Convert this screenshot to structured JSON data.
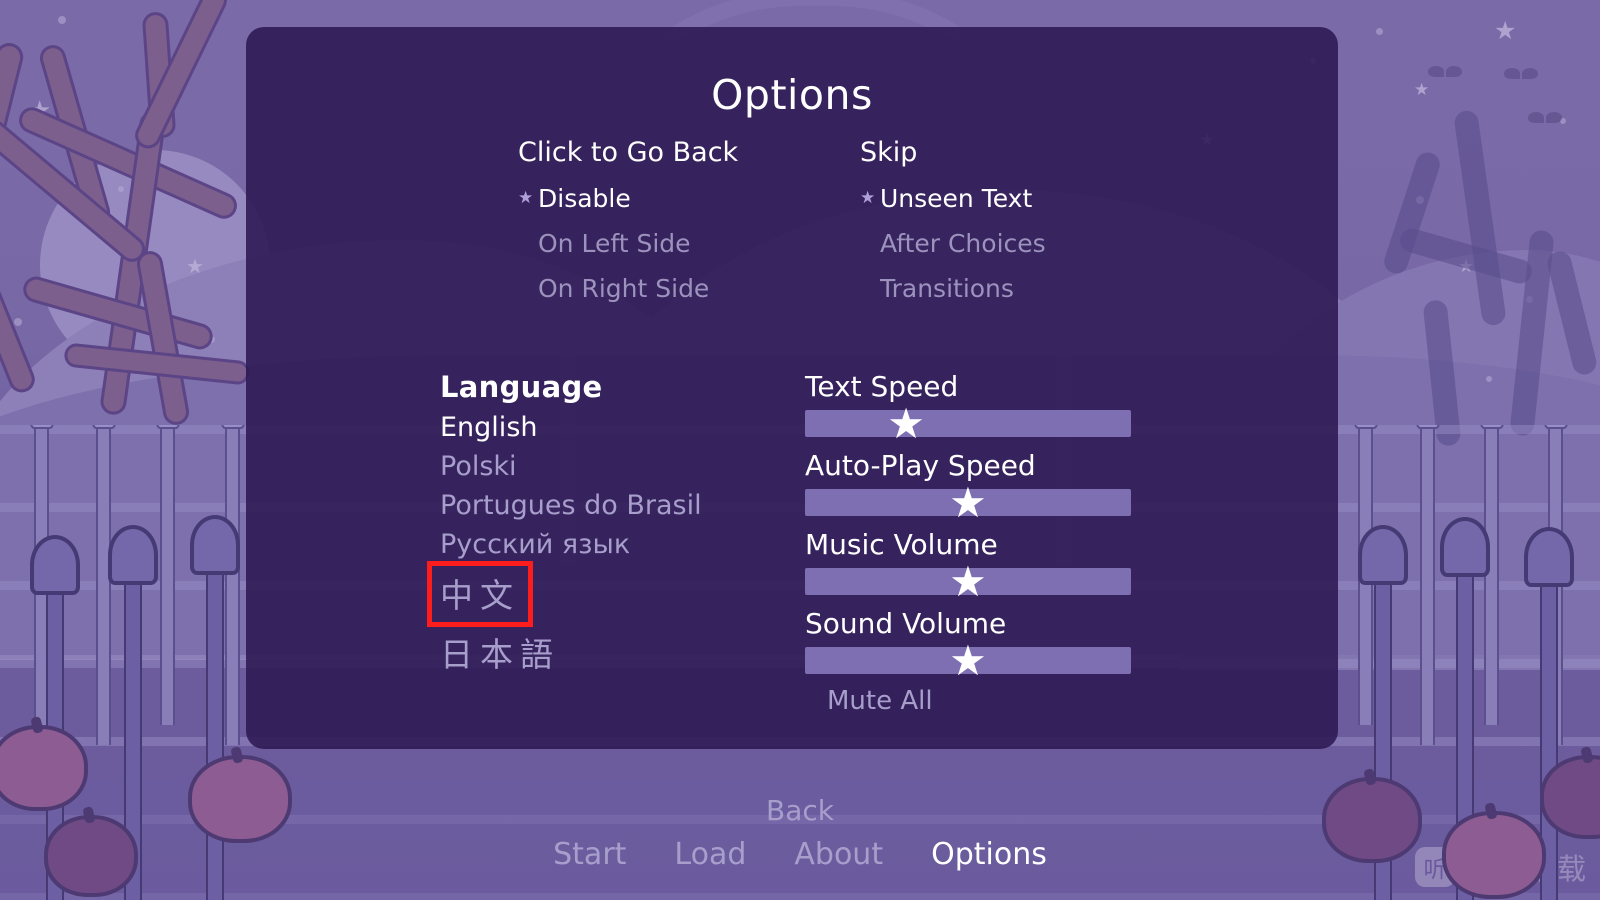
{
  "panel": {
    "title": "Options"
  },
  "prefs": [
    {
      "name": "click-to-go-back",
      "heading": "Click to Go Back",
      "options": [
        {
          "label": "Disable",
          "selected": true
        },
        {
          "label": "On Left Side",
          "selected": false
        },
        {
          "label": "On Right Side",
          "selected": false
        }
      ]
    },
    {
      "name": "skip",
      "heading": "Skip",
      "options": [
        {
          "label": "Unseen Text",
          "selected": true
        },
        {
          "label": "After Choices",
          "selected": false
        },
        {
          "label": "Transitions",
          "selected": false
        }
      ]
    }
  ],
  "language": {
    "title": "Language",
    "items": [
      {
        "label": "English",
        "current": true,
        "boxed": false,
        "cjk": false
      },
      {
        "label": "Polski",
        "current": false,
        "boxed": false,
        "cjk": false
      },
      {
        "label": "Portugues do Brasil",
        "current": false,
        "boxed": false,
        "cjk": false
      },
      {
        "label": "Русский язык",
        "current": false,
        "boxed": false,
        "cjk": false
      },
      {
        "label": "中文",
        "current": false,
        "boxed": true,
        "cjk": true
      },
      {
        "label": "日本語",
        "current": false,
        "boxed": false,
        "cjk": true
      }
    ]
  },
  "sliders": [
    {
      "name": "text-speed",
      "label": "Text Speed",
      "value": 31
    },
    {
      "name": "auto-play-speed",
      "label": "Auto-Play Speed",
      "value": 50
    },
    {
      "name": "music-volume",
      "label": "Music Volume",
      "value": 50
    },
    {
      "name": "sound-volume",
      "label": "Sound Volume",
      "value": 50
    }
  ],
  "mute_all": "Mute All",
  "nav": {
    "back": "Back",
    "items": [
      {
        "label": "Start",
        "active": false
      },
      {
        "label": "Load",
        "active": false
      },
      {
        "label": "About",
        "active": false
      },
      {
        "label": "Options",
        "active": true
      }
    ]
  },
  "watermark": {
    "icon_glyph": "听",
    "text": "一听下载"
  },
  "icons": {
    "selected_bullet": "star-bullet-icon",
    "slider_knob": "star-knob-icon"
  },
  "colors": {
    "panel_bg": "#2c1852",
    "accent_white": "#ffffff",
    "muted_text": "#a79ecb",
    "slider_track": "#7e6fb2",
    "highlight_box": "#fd1d1d"
  }
}
